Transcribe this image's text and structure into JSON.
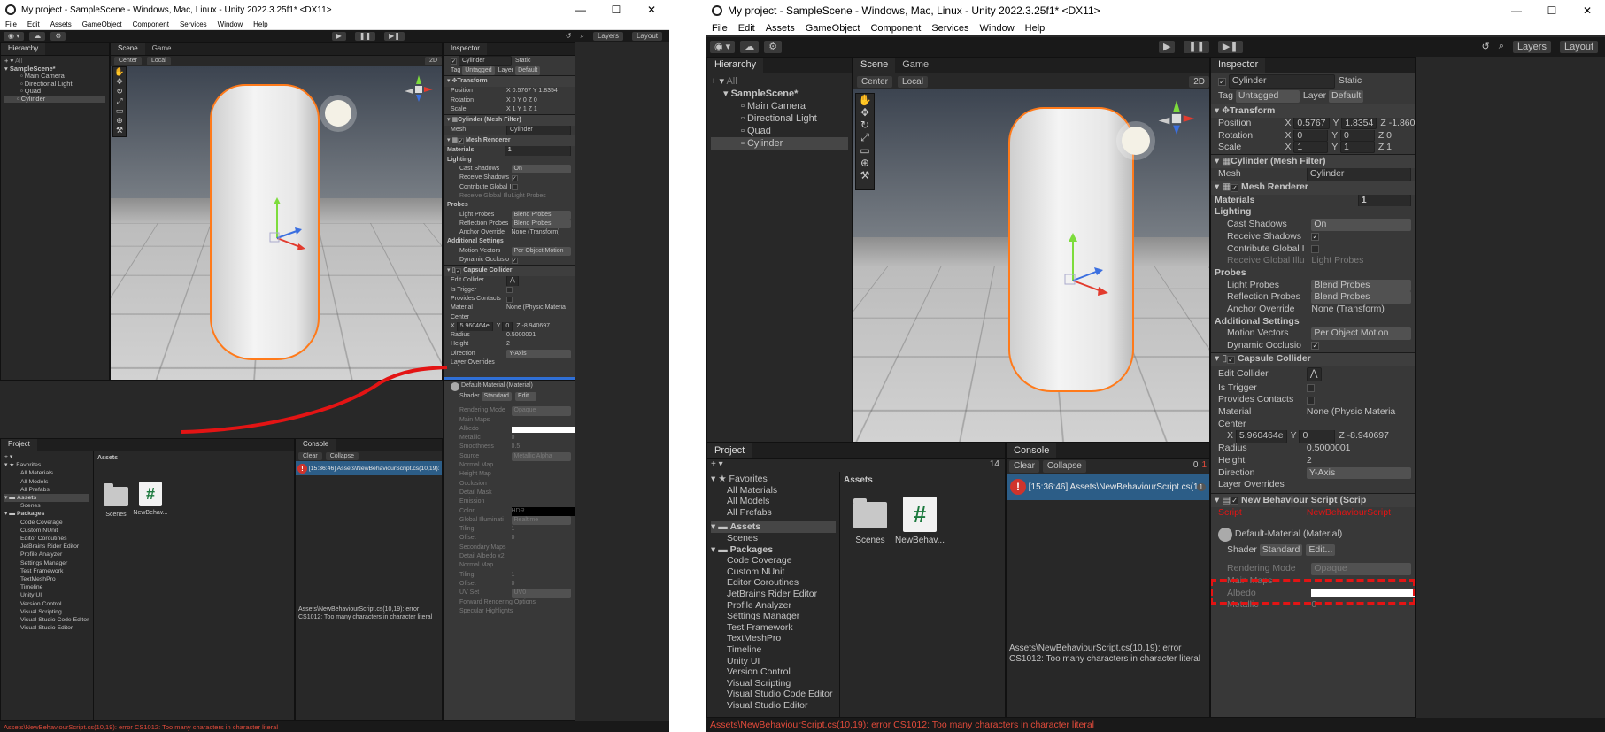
{
  "window": {
    "title": "My project - SampleScene - Windows, Mac, Linux - Unity 2022.3.25f1* <DX11>",
    "minimize": "—",
    "maximize": "☐",
    "close": "✕"
  },
  "menu": [
    "File",
    "Edit",
    "Assets",
    "GameObject",
    "Component",
    "Services",
    "Window",
    "Help"
  ],
  "toolbar": {
    "layers": "Layers",
    "layout": "Layout"
  },
  "hierarchy": {
    "tab": "Hierarchy",
    "search_placeholder": "All",
    "scene": "SampleScene*",
    "items": [
      "Main Camera",
      "Directional Light",
      "Quad",
      "Cylinder"
    ]
  },
  "scene_tabs": {
    "scene": "Scene",
    "game": "Game"
  },
  "scene_toolbar": {
    "pivot": "Center",
    "space": "Local",
    "mode2d": "2D",
    "persp": "Persp"
  },
  "inspector": {
    "tab": "Inspector",
    "object_name": "Cylinder",
    "static": "Static",
    "tag_label": "Tag",
    "tag": "Untagged",
    "layer_label": "Layer",
    "layer": "Default",
    "transform": {
      "title": "Transform",
      "position_label": "Position",
      "pos_x": "0.5767",
      "pos_y": "1.8354",
      "pos_z": "-1.860",
      "rotation_label": "Rotation",
      "rot_x": "0",
      "rot_y": "0",
      "rot_z": "0",
      "scale_label": "Scale",
      "sc_x": "1",
      "sc_y": "1",
      "sc_z": "1"
    },
    "mesh_filter": {
      "title": "Cylinder (Mesh Filter)",
      "mesh_label": "Mesh",
      "mesh": "Cylinder"
    },
    "mesh_renderer": {
      "title": "Mesh Renderer",
      "materials": "Materials",
      "materials_count": "1",
      "lighting": "Lighting",
      "cast_shadows": "Cast Shadows",
      "cast_val": "On",
      "receive_shadows": "Receive Shadows",
      "contribute_gi": "Contribute Global I",
      "receive_gi": "Receive Global Illu",
      "receive_gi_val": "Light Probes",
      "probes": "Probes",
      "light_probes": "Light Probes",
      "light_probes_val": "Blend Probes",
      "refl_probes": "Reflection Probes",
      "refl_probes_val": "Blend Probes",
      "anchor": "Anchor Override",
      "anchor_val": "None (Transform)",
      "additional": "Additional Settings",
      "motion": "Motion Vectors",
      "motion_val": "Per Object Motion",
      "dynamic_occ": "Dynamic Occlusio"
    },
    "capsule": {
      "title": "Capsule Collider",
      "edit": "Edit Collider",
      "trigger": "Is Trigger",
      "contacts": "Provides Contacts",
      "material": "Material",
      "material_val": "None (Physic Materia",
      "center": "Center",
      "c_x": "5.960464e",
      "c_y": "0",
      "c_z": "-8.940697",
      "radius": "Radius",
      "radius_val": "0.5000001",
      "height": "Height",
      "height_val": "2",
      "direction": "Direction",
      "direction_val": "Y-Axis",
      "layer_overrides": "Layer Overrides"
    },
    "new_script": {
      "title": "New Behaviour Script (Scrip",
      "script_label": "Script",
      "script_val": "NewBehaviourScript"
    },
    "material": {
      "title": "Default-Material (Material)",
      "shader_label": "Shader",
      "shader": "Standard",
      "edit": "Edit...",
      "rendering_mode": "Rendering Mode",
      "rendering_val": "Opaque",
      "main_maps": "Main Maps",
      "albedo": "Albedo",
      "metallic": "Metallic",
      "smoothness": "Smoothness",
      "smooth_val": "0.5",
      "source": "Source",
      "source_val": "Metallic Alpha",
      "normal": "Normal Map",
      "height_map": "Height Map",
      "occlusion": "Occlusion",
      "detail": "Detail Mask",
      "emission": "Emission",
      "color": "Color",
      "hdr": "HDR",
      "gi": "Global Illuminati",
      "gi_val": "Realtime",
      "tiling": "Tiling",
      "offset": "Offset",
      "one": "1",
      "zero": "0",
      "secondary": "Secondary Maps",
      "detail_albedo": "Detail Albedo x2",
      "normal2": "Normal Map",
      "uv": "UV Set",
      "uv_val": "UV0",
      "forward": "Forward Rendering Options",
      "specular": "Specular Highlights"
    }
  },
  "project": {
    "tab": "Project",
    "favorites": "Favorites",
    "fav_items": [
      "All Materials",
      "All Models",
      "All Prefabs"
    ],
    "assets": "Assets",
    "assets_children": [
      "Scenes"
    ],
    "packages": "Packages",
    "package_items": [
      "Code Coverage",
      "Custom NUnit",
      "Editor Coroutines",
      "JetBrains Rider Editor",
      "Profile Analyzer",
      "Settings Manager",
      "Test Framework",
      "TextMeshPro",
      "Timeline",
      "Unity UI",
      "Version Control",
      "Visual Scripting",
      "Visual Studio Code Editor",
      "Visual Studio Editor"
    ],
    "breadcrumb": "Assets",
    "asset_scenes": "Scenes",
    "asset_script": "NewBehav...",
    "count": "14"
  },
  "console": {
    "tab": "Console",
    "clear": "Clear",
    "collapse": "Collapse",
    "count_zero": "0",
    "count_one": "1",
    "entry": "[15:36:46] Assets\\NewBehaviourScript.cs(10,19): e",
    "entry_count": "1",
    "detail": "Assets\\NewBehaviourScript.cs(10,19): error CS1012: Too many characters in character literal"
  },
  "status": "Assets\\NewBehaviourScript.cs(10,19): error CS1012: Too many characters in character literal",
  "colors": {
    "error": "#e24b3b",
    "selection": "#2c5d87",
    "outline": "#ff7a1a",
    "annotation": "#e31414"
  }
}
